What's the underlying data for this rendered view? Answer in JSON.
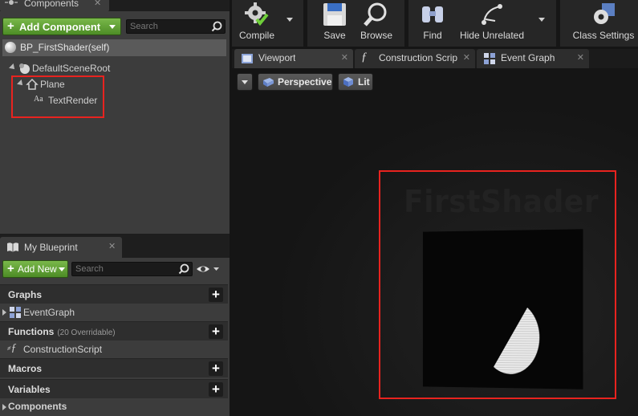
{
  "components_panel": {
    "tab_label": "Components",
    "add_component_label": "Add Component",
    "search_placeholder": "Search",
    "self_label": "BP_FirstShader(self)",
    "tree": [
      {
        "label": "DefaultSceneRoot",
        "icon": "scene-root-icon"
      },
      {
        "label": "Plane",
        "icon": "static-mesh-icon"
      },
      {
        "label": "TextRender",
        "icon": "text-render-icon"
      }
    ]
  },
  "my_blueprint": {
    "tab_label": "My Blueprint",
    "add_new_label": "Add New",
    "search_placeholder": "Search",
    "sections": {
      "graphs": {
        "label": "Graphs",
        "items": [
          "EventGraph"
        ]
      },
      "functions": {
        "label": "Functions",
        "sub": "(20 Overridable)",
        "items": [
          "ConstructionScript"
        ]
      },
      "macros": {
        "label": "Macros"
      },
      "variables": {
        "label": "Variables",
        "items": [
          "Components"
        ]
      }
    }
  },
  "toolbar": {
    "compile": "Compile",
    "save": "Save",
    "browse": "Browse",
    "find": "Find",
    "hide_unrelated": "Hide Unrelated",
    "class_settings": "Class Settings"
  },
  "doc_tabs": [
    {
      "label": "Viewport",
      "icon": "viewport-icon",
      "active": true
    },
    {
      "label": "Construction Scrip",
      "icon": "function-icon",
      "active": false
    },
    {
      "label": "Event Graph",
      "icon": "graph-icon",
      "active": false
    }
  ],
  "viewport": {
    "perspective_label": "Perspective",
    "lit_label": "Lit",
    "scene_text": "FirstShader"
  },
  "colors": {
    "accent_green": "#5ea332",
    "highlight_red": "#e8231f"
  }
}
